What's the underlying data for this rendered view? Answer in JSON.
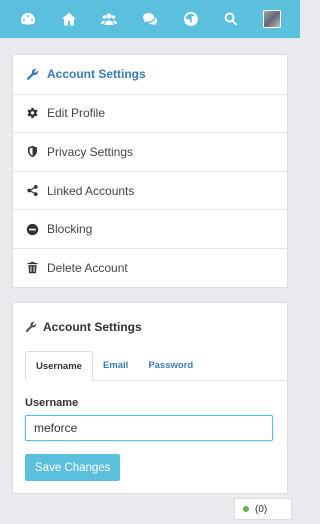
{
  "topbar": {
    "icons": [
      "dashboard-icon",
      "home-icon",
      "users-icon",
      "chat-icon",
      "globe-icon",
      "search-icon",
      "avatar"
    ]
  },
  "menu": {
    "items": [
      {
        "label": "Account Settings",
        "icon": "wrench-icon"
      },
      {
        "label": "Edit Profile",
        "icon": "gear-icon"
      },
      {
        "label": "Privacy Settings",
        "icon": "shield-icon"
      },
      {
        "label": "Linked Accounts",
        "icon": "share-icon"
      },
      {
        "label": "Blocking",
        "icon": "minus-circle-icon"
      },
      {
        "label": "Delete Account",
        "icon": "trash-icon"
      }
    ]
  },
  "settings": {
    "title": "Account Settings",
    "tabs": [
      "Username",
      "Email",
      "Password"
    ],
    "field_label": "Username",
    "field_value": "meforce",
    "save_label": "Save Changes"
  },
  "status": {
    "count": "(0)"
  },
  "colors": {
    "accent": "#5bc0de",
    "link": "#3a7bb8",
    "online": "#6bb44a"
  }
}
